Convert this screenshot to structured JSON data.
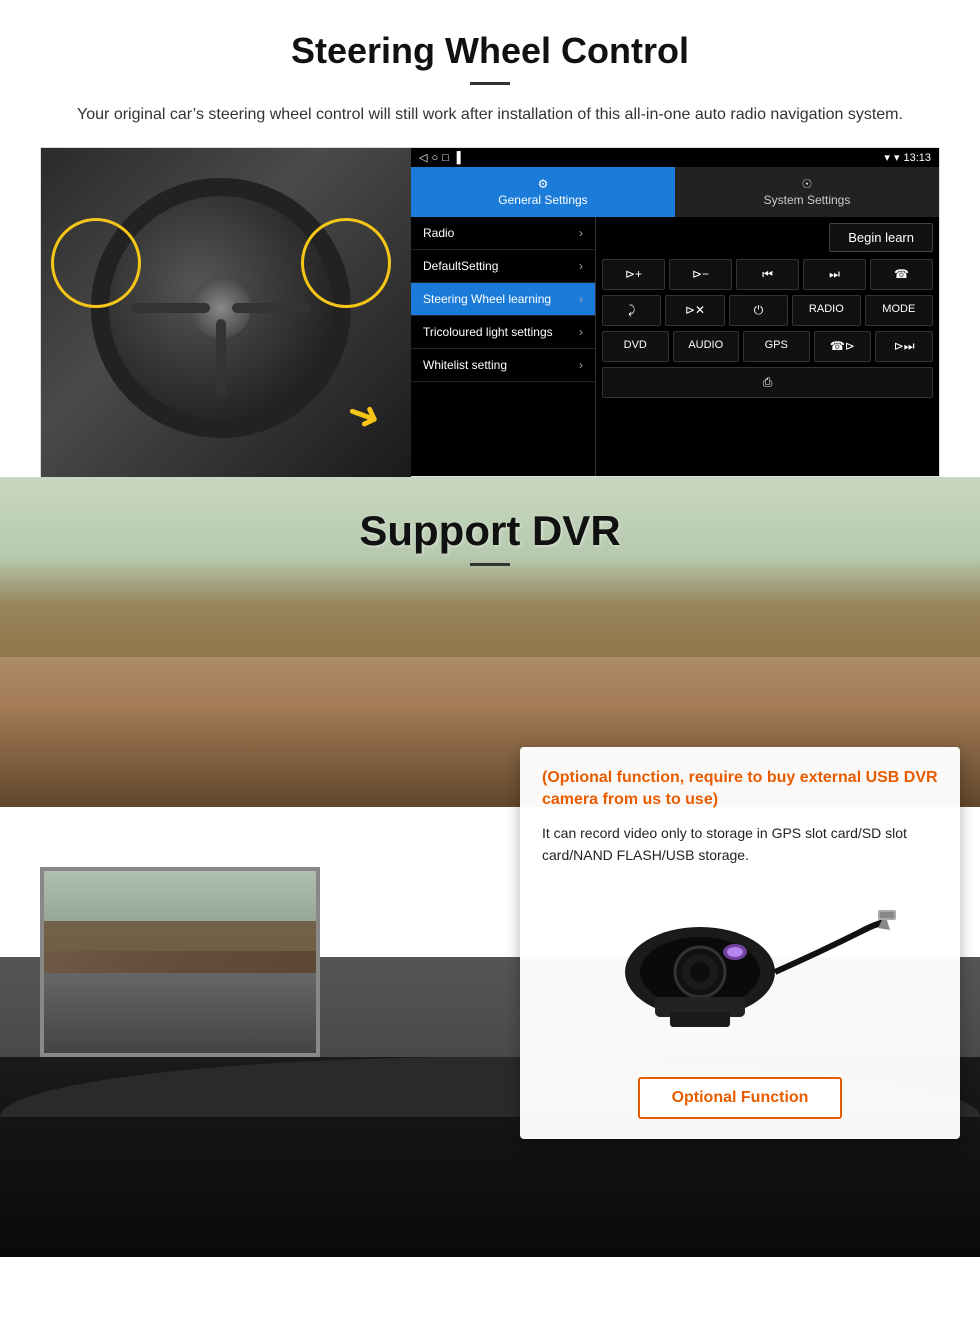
{
  "page": {
    "section1": {
      "title": "Steering Wheel Control",
      "subtitle": "Your original car’s steering wheel control will still work after installation of this all-in-one auto radio navigation system."
    },
    "android": {
      "statusbar": {
        "time": "13:13",
        "icons": [
          "signal-icon",
          "wifi-icon",
          "battery-icon"
        ]
      },
      "nav_buttons": [
        "◁",
        "○",
        "□",
        "▐"
      ],
      "tabs": [
        {
          "label": "General Settings",
          "icon": "⚙",
          "active": true
        },
        {
          "label": "System Settings",
          "icon": "☉",
          "active": false
        }
      ],
      "menu_items": [
        {
          "label": "Radio",
          "active": false
        },
        {
          "label": "DefaultSetting",
          "active": false
        },
        {
          "label": "Steering Wheel learning",
          "active": true
        },
        {
          "label": "Tricoloured light settings",
          "active": false
        },
        {
          "label": "Whitelist setting",
          "active": false
        }
      ],
      "begin_learn_label": "Begin learn",
      "control_rows": [
        [
          "⧐+",
          "⧐−",
          "⎮◂◂",
          "▶▶⎮",
          "☎"
        ],
        [
          "⬐",
          "⧐×",
          "⏻",
          "RADIO",
          "MODE"
        ],
        [
          "DVD",
          "AUDIO",
          "GPS",
          "☎⧐◂",
          "⧐▶⎮"
        ],
        [
          "⎙"
        ]
      ]
    },
    "section2": {
      "title": "Support DVR",
      "optional_text": "(Optional function, require to buy external USB DVR camera from us to use)",
      "desc_text": "It can record video only to storage in GPS slot card/SD slot card/NAND FLASH/USB storage.",
      "optional_fn_label": "Optional Function"
    }
  }
}
